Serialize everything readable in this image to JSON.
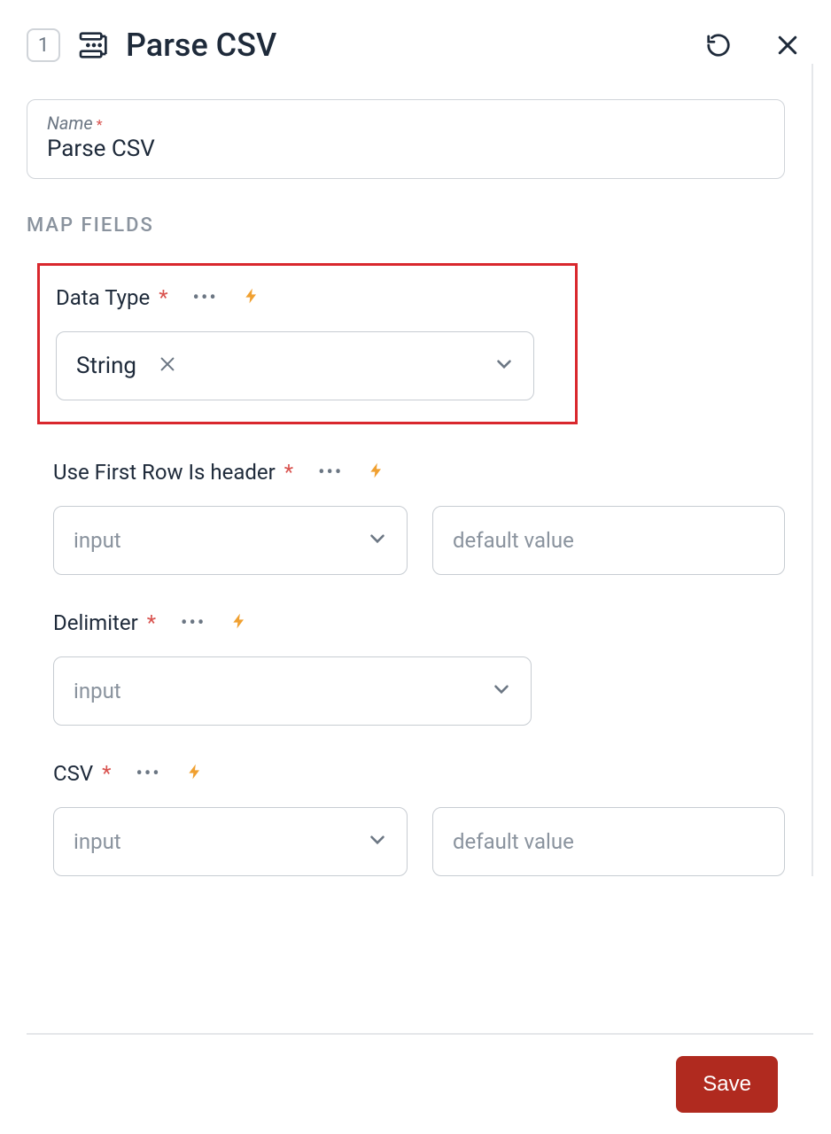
{
  "header": {
    "step": "1",
    "title": "Parse CSV"
  },
  "name_field": {
    "label": "Name",
    "value": "Parse CSV"
  },
  "section": "MAP FIELDS",
  "fields": {
    "data_type": {
      "label": "Data Type",
      "value": "String"
    },
    "first_row": {
      "label": "Use First Row Is header",
      "input_placeholder": "input",
      "default_placeholder": "default value"
    },
    "delimiter": {
      "label": "Delimiter",
      "input_placeholder": "input"
    },
    "csv": {
      "label": "CSV",
      "input_placeholder": "input",
      "default_placeholder": "default value"
    }
  },
  "footer": {
    "save": "Save"
  }
}
